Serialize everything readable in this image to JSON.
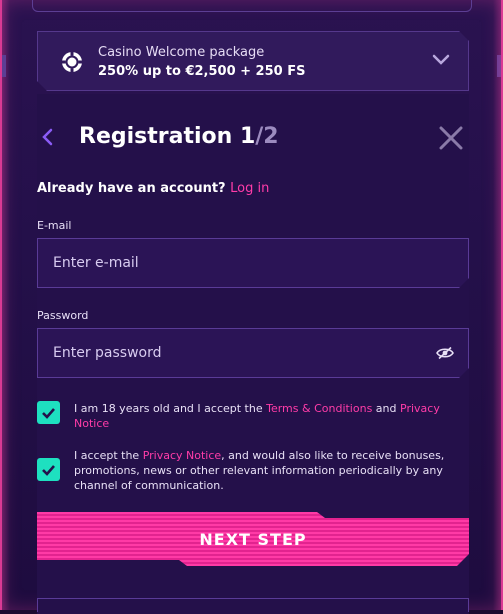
{
  "bonus": {
    "subtitle": "Casino Welcome package",
    "offer": "250% up to €2,500 + 250 FS"
  },
  "header": {
    "title": "Registration ",
    "step_current": "1",
    "step_sep_total": "/2"
  },
  "login_prompt": {
    "text": "Already have an account? ",
    "link": "Log in"
  },
  "email": {
    "label": "E-mail",
    "placeholder": "Enter e-mail"
  },
  "password": {
    "label": "Password",
    "placeholder": "Enter password"
  },
  "consent_age": {
    "checked": true,
    "text_before": "I am 18 years old and I accept the ",
    "link1": "Terms & Conditions",
    "text_mid": " and ",
    "link2": "Privacy Notice"
  },
  "consent_marketing": {
    "checked": true,
    "text_before": "I accept the ",
    "link": "Privacy Notice",
    "text_after": ", and would also like to receive bonuses, promotions, news or other relevant information periodically by any channel of communication."
  },
  "next_button": {
    "label": "NEXT STEP"
  },
  "colors": {
    "accent_pink": "#ff3ca8",
    "checkbox_teal": "#1ee0c0",
    "panel_bg": "#24104a"
  }
}
